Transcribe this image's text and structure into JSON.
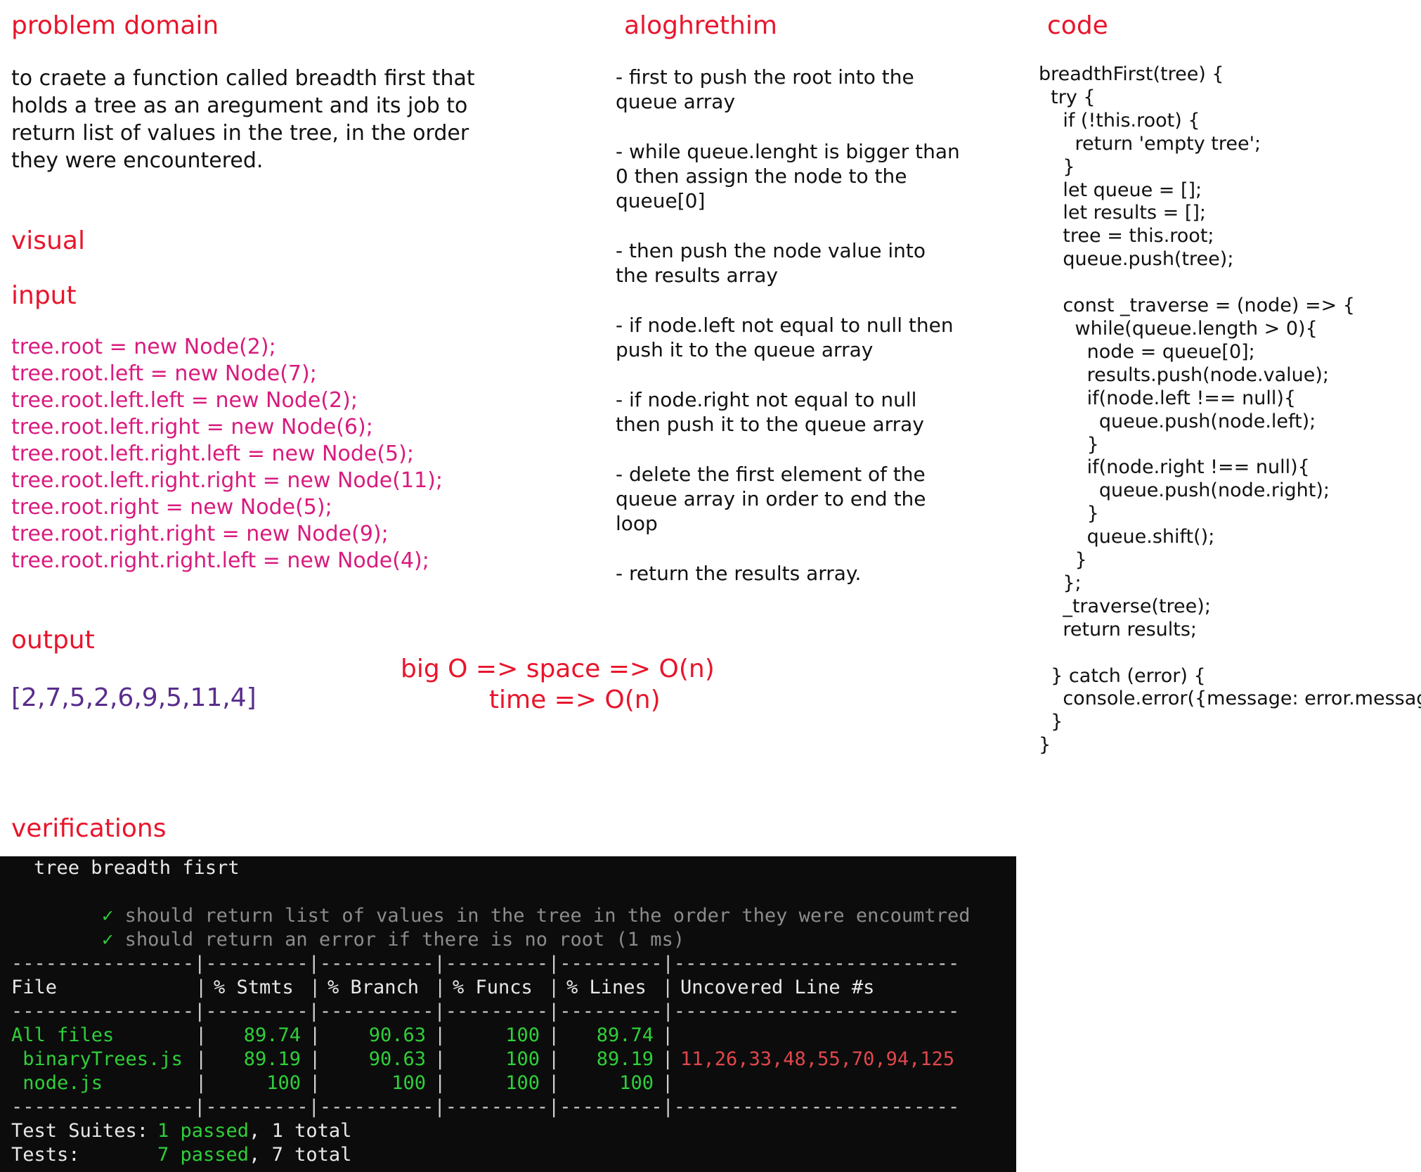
{
  "problem": {
    "heading": "problem domain",
    "text": "to craete a function called breadth first that\nholds a tree as an aregument and its job to\nreturn list of values in the tree, in the order\nthey were encountered."
  },
  "visual": {
    "heading": "visual"
  },
  "input": {
    "heading": "input",
    "code": "tree.root = new Node(2);\ntree.root.left = new Node(7);\ntree.root.left.left = new Node(2);\ntree.root.left.right = new Node(6);\ntree.root.left.right.left = new Node(5);\ntree.root.left.right.right = new Node(11);\ntree.root.right = new Node(5);\ntree.root.right.right = new Node(9);\ntree.root.right.right.left = new Node(4);"
  },
  "output": {
    "heading": "output",
    "value": "[2,7,5,2,6,9,5,11,4]"
  },
  "bigo": {
    "text": "big O => space => O(n)\n           time => O(n)"
  },
  "algorithm": {
    "heading": "aloghrethim",
    "steps": [
      "- first to push the root into the\nqueue array",
      "- while queue.lenght is bigger than\n0 then assign the node to the\nqueue[0]",
      "- then push the node value into\nthe results array",
      "- if node.left not equal to null then\npush it to the queue array",
      "- if node.right not equal to null\nthen push it to the queue array",
      "- delete the first element of the\nqueue array in order to end the\nloop",
      "- return the results array."
    ]
  },
  "code": {
    "heading": "code",
    "text": "breadthFirst(tree) {\n  try {\n    if (!this.root) {\n      return 'empty tree';\n    }\n    let queue = [];\n    let results = [];\n    tree = this.root;\n    queue.push(tree);\n\n    const _traverse = (node) => {\n      while(queue.length > 0){\n        node = queue[0];\n        results.push(node.value);\n        if(node.left !== null){\n          queue.push(node.left);\n        }\n        if(node.right !== null){\n          queue.push(node.right);\n        }\n        queue.shift();\n      }\n    };\n    _traverse(tree);\n    return results;\n\n  } catch (error) {\n    console.error({message: error.message});\n  }\n}"
  },
  "verifications": {
    "heading": "verifications",
    "suite": "tree breadth fisrt",
    "check_mark": "✓",
    "tests": [
      "should return list of values in the tree in the order they were encoumtred",
      "should return an error if there is no root (1 ms)"
    ],
    "separator": "----------------|---------|----------|---------|---------|-------------------------",
    "table": {
      "headers": [
        "File",
        "% Stmts",
        "% Branch",
        "% Funcs",
        "% Lines",
        "Uncovered Line #s"
      ],
      "rows": [
        {
          "file": "All files",
          "stmts": "89.74",
          "branch": "90.63",
          "funcs": "100",
          "lines": "89.74",
          "uncovered": ""
        },
        {
          "file": " binaryTrees.js",
          "stmts": "89.19",
          "branch": "90.63",
          "funcs": "100",
          "lines": "89.19",
          "uncovered": "11,26,33,48,55,70,94,125"
        },
        {
          "file": " node.js",
          "stmts": "100",
          "branch": "100",
          "funcs": "100",
          "lines": "100",
          "uncovered": ""
        }
      ]
    },
    "summary": {
      "suites_label": "Test Suites:",
      "suites_passed": "1 passed",
      "suites_total": "1 total",
      "tests_label": "Tests:",
      "tests_passed": "7 passed",
      "tests_total": "7 total"
    },
    "colors": {
      "pass": "#2fcf3a",
      "fail": "#e0474c",
      "background": "#0c0c0c"
    }
  }
}
